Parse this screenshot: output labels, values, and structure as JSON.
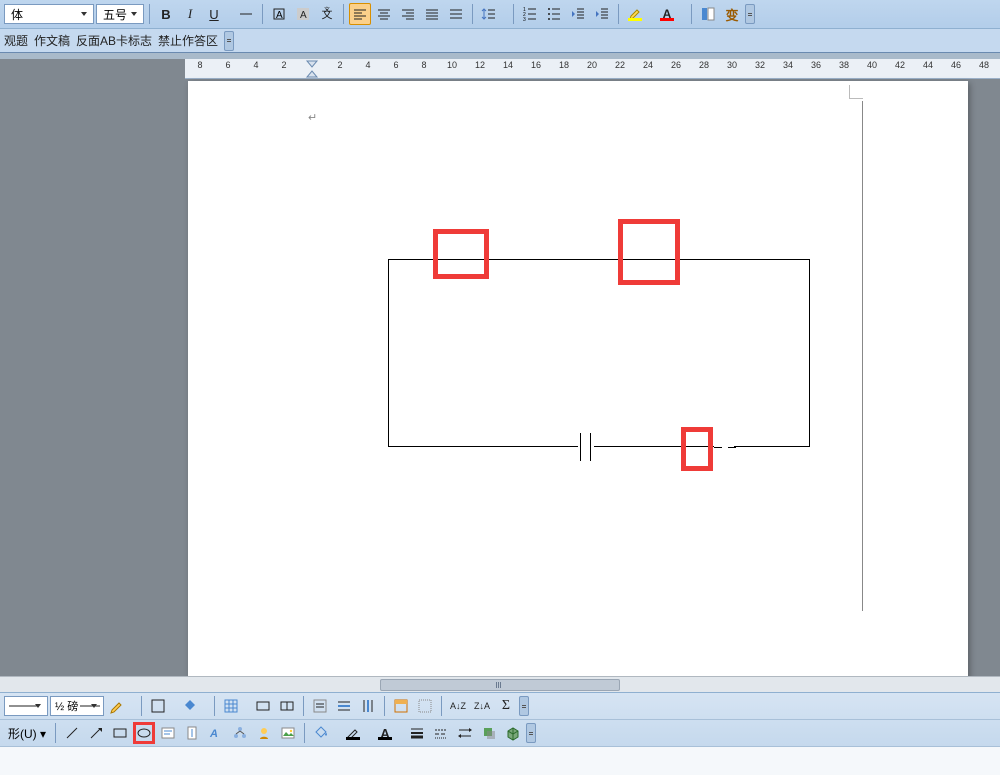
{
  "toolbar": {
    "font_name": "体",
    "font_size": "五号",
    "bold": "B",
    "italic": "I",
    "underline": "U",
    "highlight_color": "#ffff00",
    "font_color": "#ff0000"
  },
  "secondary_tabs": [
    "观题",
    "作文稿",
    "反面AB卡标志",
    "禁止作答区"
  ],
  "ruler": {
    "left_ticks": [
      8,
      6,
      4,
      2
    ],
    "right_ticks": [
      2,
      4,
      6,
      8,
      10,
      12,
      14,
      16,
      18,
      20,
      22,
      24,
      26,
      28,
      30,
      32,
      34,
      36,
      38,
      40,
      42,
      44,
      46,
      48
    ]
  },
  "bottom": {
    "line_weight": "½ 磅",
    "autoshape_label": "形(U)",
    "sort_az": "A↓Z",
    "sort_za": "Z↓A",
    "sigma": "Σ"
  },
  "status_text": ""
}
